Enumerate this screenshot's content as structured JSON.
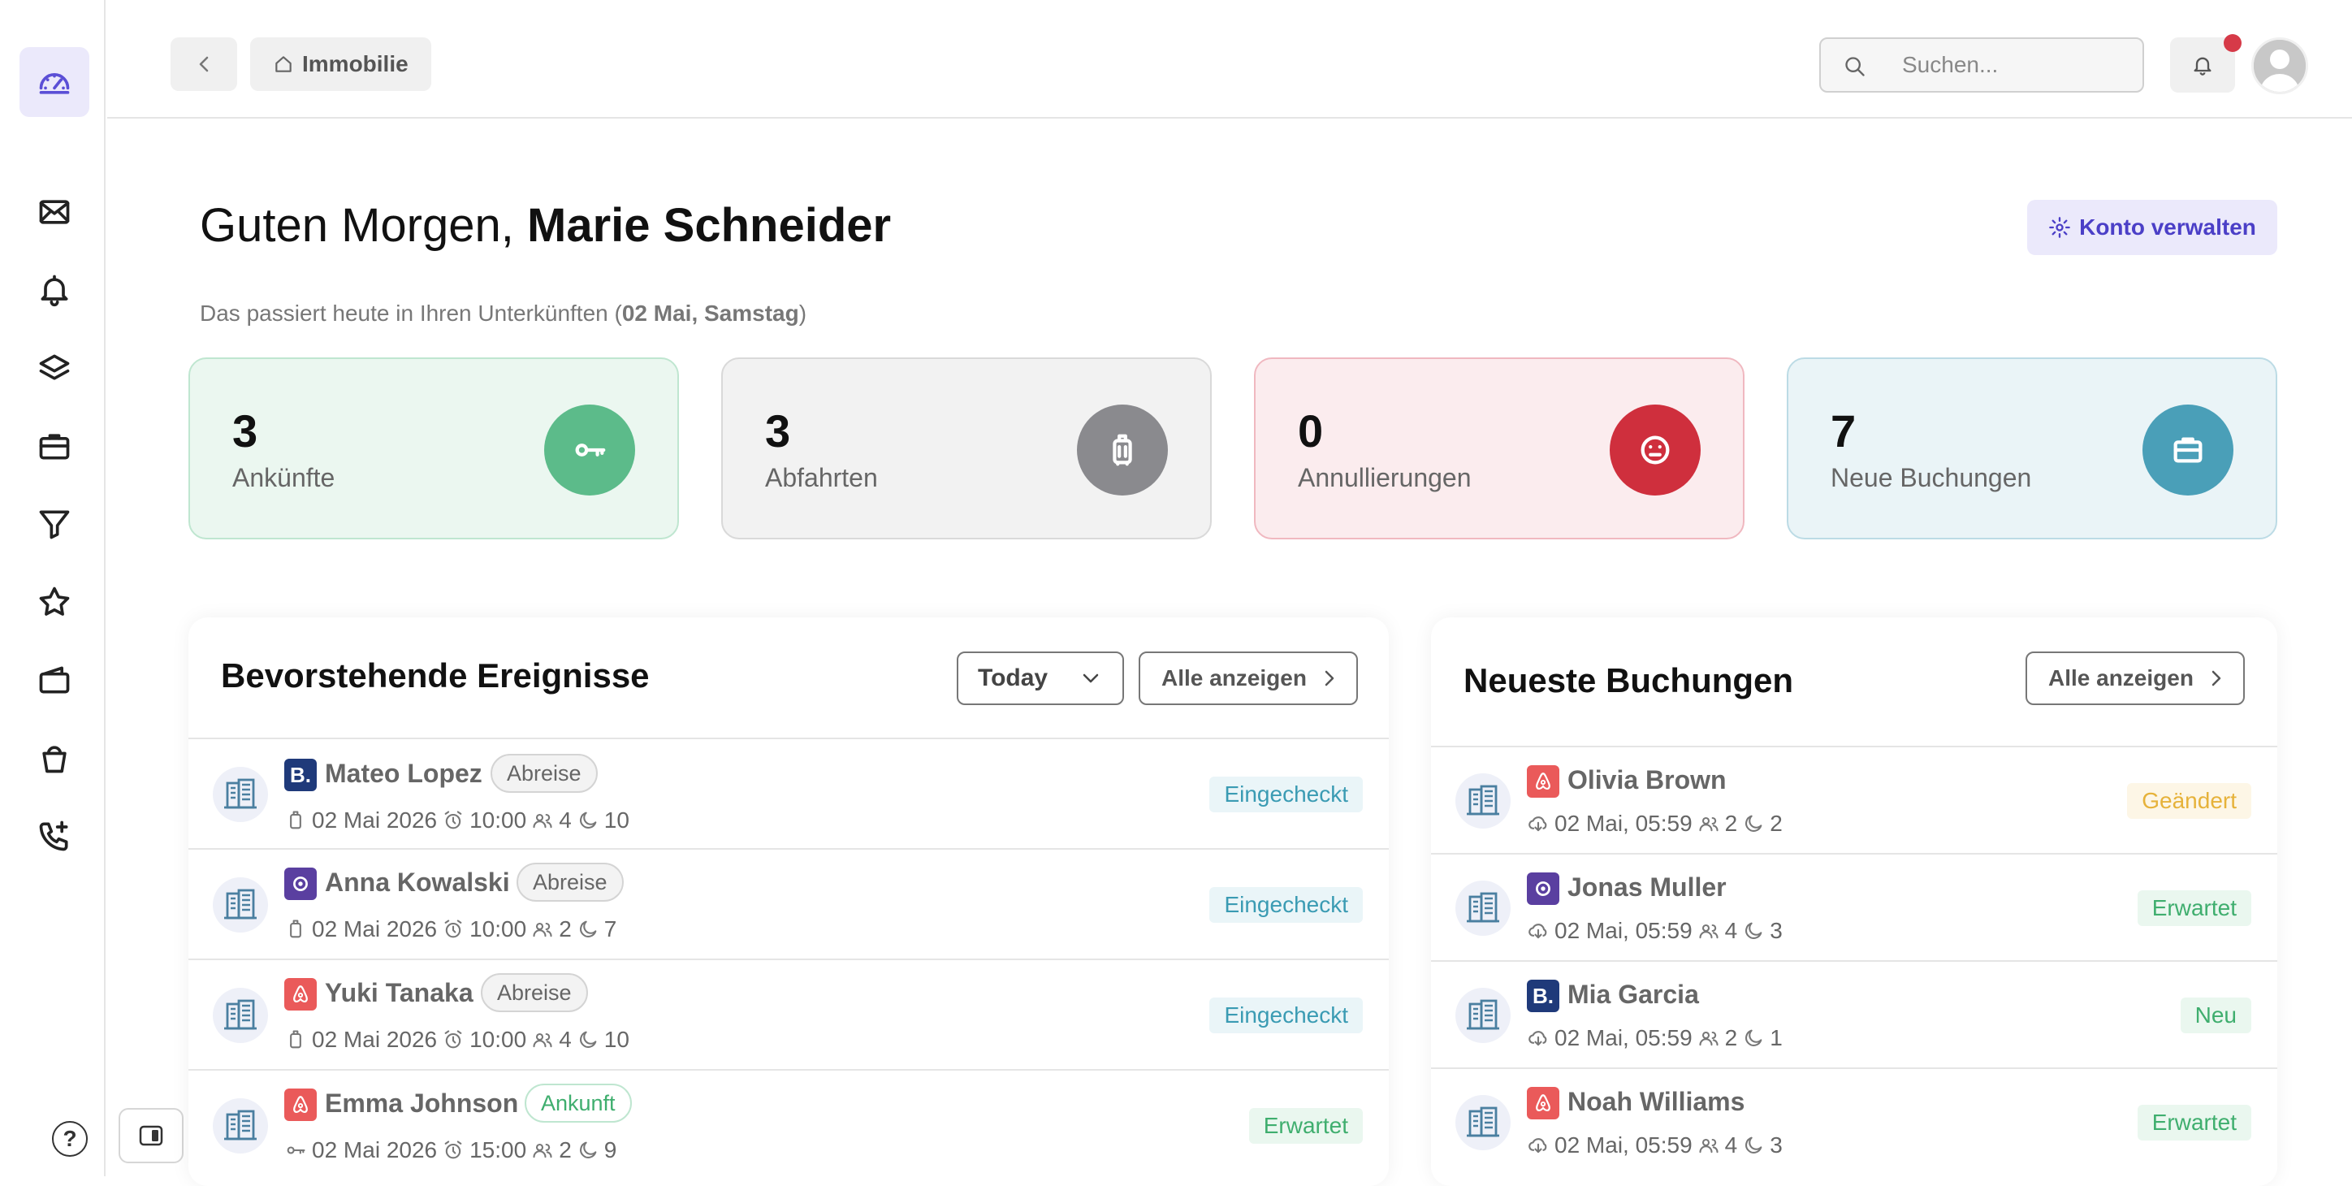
{
  "topbar": {
    "breadcrumb": "Immobilie",
    "search_placeholder": "Suchen..."
  },
  "header": {
    "greeting_prefix": "Guten Morgen,",
    "user_name": "Marie Schneider",
    "manage_label": "Konto verwalten",
    "subline_prefix": "Das passiert heute in Ihren Unterkünften (",
    "subline_date": "02 Mai, Samstag",
    "subline_suffix": ")"
  },
  "stats": [
    {
      "value": "3",
      "label": "Ankünfte",
      "icon": "key-icon",
      "color": "#5cbb8a"
    },
    {
      "value": "3",
      "label": "Abfahrten",
      "icon": "luggage-icon",
      "color": "#8a8a8e"
    },
    {
      "value": "0",
      "label": "Annullierungen",
      "icon": "frown-icon",
      "color": "#cf2f3d"
    },
    {
      "value": "7",
      "label": "Neue Buchungen",
      "icon": "briefcase-icon",
      "color": "#4a9fb8"
    }
  ],
  "events": {
    "title": "Bevorstehende Ereignisse",
    "filter": "Today",
    "view_all": "Alle anzeigen",
    "rows": [
      {
        "name": "Mateo Lopez",
        "platform": "B.",
        "tag": "Abreise",
        "date": "02 Mai 2026",
        "time": "10:00",
        "guests": "4",
        "nights": "10",
        "status": "Eingecheckt"
      },
      {
        "name": "Anna Kowalski",
        "platform": "vrbo",
        "tag": "Abreise",
        "date": "02 Mai 2026",
        "time": "10:00",
        "guests": "2",
        "nights": "7",
        "status": "Eingecheckt"
      },
      {
        "name": "Yuki Tanaka",
        "platform": "airbnb",
        "tag": "Abreise",
        "date": "02 Mai 2026",
        "time": "10:00",
        "guests": "4",
        "nights": "10",
        "status": "Eingecheckt"
      },
      {
        "name": "Emma Johnson",
        "platform": "airbnb",
        "tag": "Ankunft",
        "date": "02 Mai 2026",
        "time": "15:00",
        "guests": "2",
        "nights": "9",
        "status": "Erwartet"
      }
    ]
  },
  "bookings": {
    "title": "Neueste Buchungen",
    "view_all": "Alle anzeigen",
    "rows": [
      {
        "name": "Olivia Brown",
        "platform": "airbnb",
        "date": "02 Mai, 05:59",
        "guests": "2",
        "nights": "2",
        "status": "Geändert"
      },
      {
        "name": "Jonas Muller",
        "platform": "vrbo",
        "date": "02 Mai, 05:59",
        "guests": "4",
        "nights": "3",
        "status": "Erwartet"
      },
      {
        "name": "Mia Garcia",
        "platform": "B.",
        "date": "02 Mai, 05:59",
        "guests": "2",
        "nights": "1",
        "status": "Neu"
      },
      {
        "name": "Noah Williams",
        "platform": "airbnb",
        "date": "02 Mai, 05:59",
        "guests": "4",
        "nights": "3",
        "status": "Erwartet"
      }
    ]
  },
  "help_label": "?"
}
